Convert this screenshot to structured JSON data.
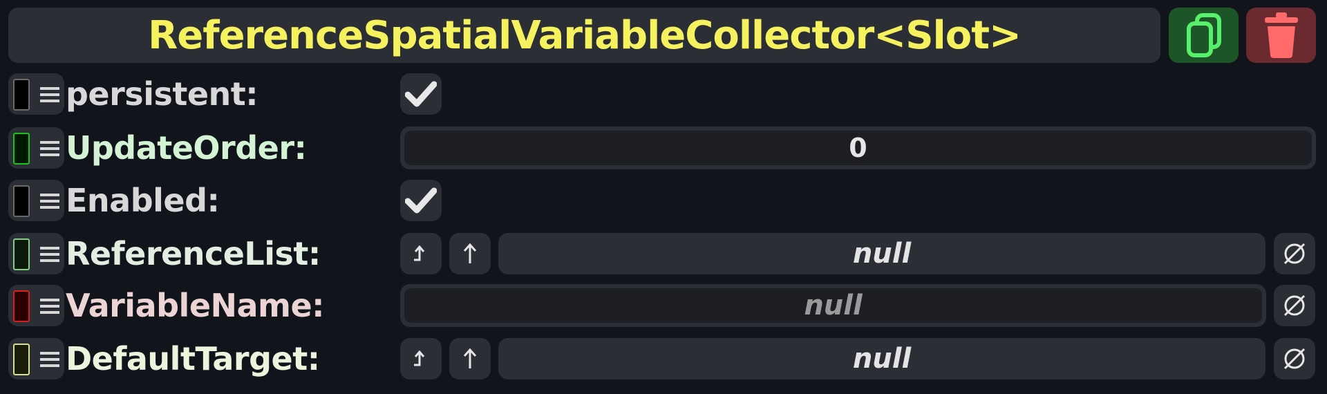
{
  "header": {
    "title": "ReferenceSpatialVariableCollector<Slot>",
    "duplicate_icon": "duplicate-icon",
    "delete_icon": "trash-icon"
  },
  "fields": [
    {
      "label": "persistent:",
      "label_color": "#d8d8d8",
      "swatch_color": "#6a6a6a",
      "kind": "checkbox",
      "checked": true
    },
    {
      "label": "UpdateOrder:",
      "label_color": "#d4f3d4",
      "swatch_color": "#19c319",
      "kind": "number",
      "value": "0"
    },
    {
      "label": "Enabled:",
      "label_color": "#d8d8d8",
      "swatch_color": "#6a6a6a",
      "kind": "checkbox",
      "checked": true
    },
    {
      "label": "ReferenceList:",
      "label_color": "#e3eee3",
      "swatch_color": "#7fd27f",
      "kind": "reference",
      "value": "null"
    },
    {
      "label": "VariableName:",
      "label_color": "#ecd4d4",
      "swatch_color": "#d51e1e",
      "kind": "text",
      "value": "null"
    },
    {
      "label": "DefaultTarget:",
      "label_color": "#eef3de",
      "swatch_color": "#d7e28a",
      "kind": "reference",
      "value": "null"
    }
  ]
}
